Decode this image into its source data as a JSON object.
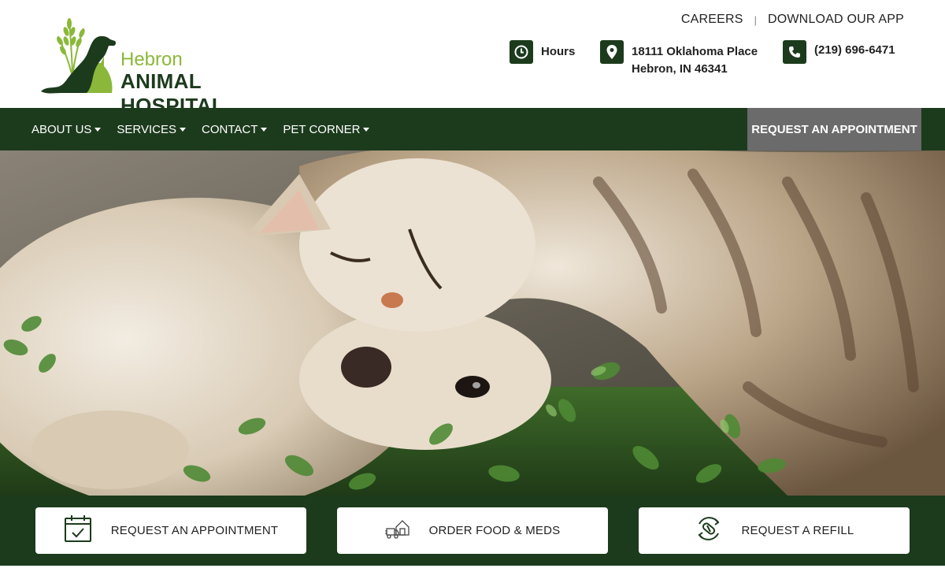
{
  "logo": {
    "line1": "Hebron",
    "line2": "ANIMAL HOSPITAL"
  },
  "toplinks": {
    "careers": "CAREERS",
    "separator": "|",
    "app": "DOWNLOAD OUR APP"
  },
  "info": {
    "hours": {
      "label": "Hours",
      "icon": "clock-icon"
    },
    "address": {
      "line1": "18111 Oklahoma Place",
      "line2": "Hebron, IN 46341",
      "icon": "map-pin-icon"
    },
    "phone": {
      "label": "(219) 696-6471",
      "icon": "phone-icon"
    }
  },
  "nav": {
    "items": [
      {
        "label": "ABOUT US"
      },
      {
        "label": "SERVICES"
      },
      {
        "label": "CONTACT"
      },
      {
        "label": "PET CORNER"
      }
    ],
    "request": "REQUEST AN APPOINTMENT"
  },
  "cta": [
    {
      "label": "REQUEST AN APPOINTMENT",
      "icon": "calendar-check-icon"
    },
    {
      "label": "ORDER FOOD & MEDS",
      "icon": "delivery-truck-icon"
    },
    {
      "label": "REQUEST A REFILL",
      "icon": "pill-refill-icon"
    }
  ],
  "colors": {
    "brand_dark": "#1c3b1d",
    "brand_green": "#8bb83a",
    "request_bg": "#6b6b6b"
  }
}
